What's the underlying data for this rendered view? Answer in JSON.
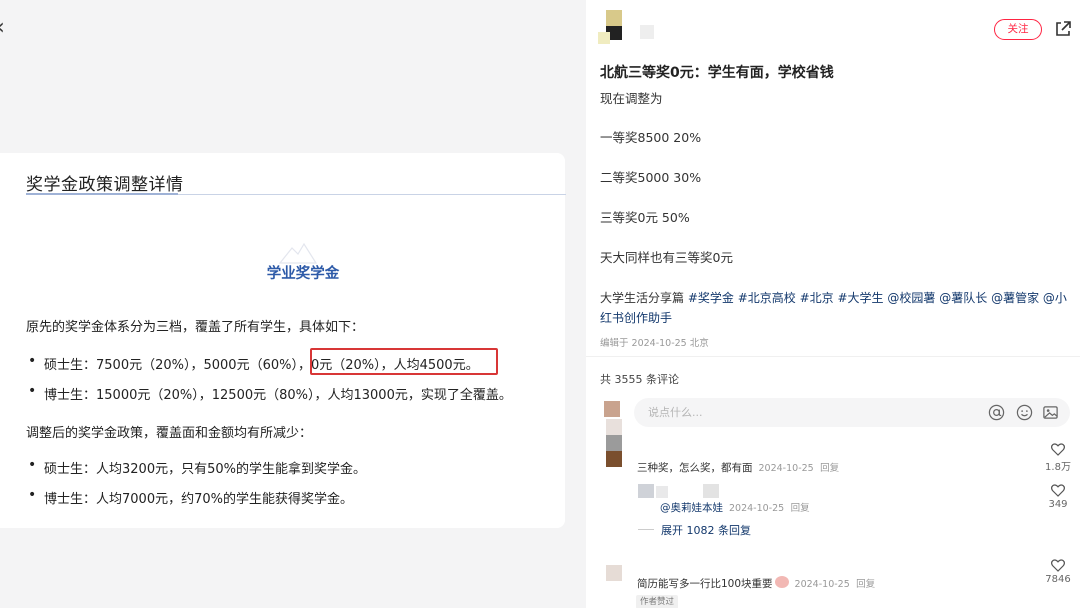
{
  "article": {
    "back_icon": "chevron-left-icon",
    "card_title": "奖学金政策调整详情",
    "section_heading": "学业奖学金",
    "intro": "原先的奖学金体系分为三档，覆盖了所有学生，具体如下：",
    "original": [
      {
        "text": "硕士生：7500元（20%），5000元（60%），0元（20%），人均4500元。"
      },
      {
        "text": "博士生：15000元（20%），12500元（80%），人均13000元，实现了全覆盖。"
      }
    ],
    "adjusted_intro": "调整后的奖学金政策，覆盖面和金额均有所减少：",
    "adjusted": [
      {
        "text": "硕士生：人均3200元，只有50%的学生能拿到奖学金。"
      },
      {
        "text": "博士生：人均7000元，约70%的学生能获得奖学金。"
      }
    ],
    "highlight_color": "#d83636"
  },
  "post": {
    "follow_label": "关注",
    "share_icon": "share-icon",
    "title": "北航三等奖0元：学生有面，学校省钱",
    "lines": [
      "现在调整为",
      "一等奖8500 20%",
      "二等奖5000 30%",
      "三等奖0元 50%",
      "天大同样也有三等奖0元"
    ],
    "tags_prefix": "大学生活分享篇 ",
    "tags": [
      "#奖学金",
      "#北京高校",
      "#北京",
      "#大学生",
      "@校园薯",
      "@薯队长",
      "@薯管家",
      "@小红书创作助手"
    ],
    "edited": "编辑于 2024-10-25 北京",
    "accent": "#ff2442",
    "link_color": "#13386c"
  },
  "comments": {
    "count_label": "共 3555 条评论",
    "input_placeholder": "说点什么...",
    "input_icons": [
      "at-icon",
      "emoji-icon",
      "image-icon"
    ],
    "items": [
      {
        "text": "三种奖，怎么奖，都有面",
        "date": "2024-10-25",
        "reply": "回复",
        "likes": "1.8万"
      },
      {
        "text": "@奥莉娃本娃",
        "date": "2024-10-25",
        "reply": "回复",
        "likes": "349"
      },
      {
        "text": "简历能写多一行比100块重要",
        "date": "2024-10-25",
        "reply": "回复",
        "likes": "7846",
        "badge": "作者赞过"
      }
    ],
    "expand_label": "展开 1082 条回复"
  }
}
